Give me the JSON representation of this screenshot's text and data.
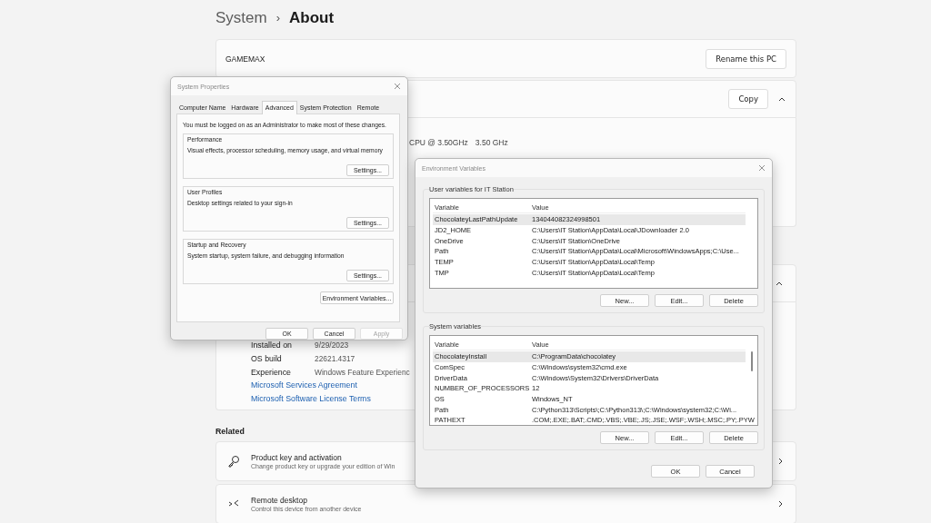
{
  "breadcrumb": {
    "parent": "System",
    "separator": "›",
    "current": "About"
  },
  "device_name": {
    "name": "GAMEMAX",
    "button": "Rename this PC"
  },
  "device_specs": {
    "expanded": true,
    "button": "Copy",
    "processor_fragment": "CPU @ 3.50GHz",
    "processor_speed": "3.50 GHz"
  },
  "windows_specs": {
    "expanded": true,
    "rows": [
      {
        "label": "Installed on",
        "value": "9/29/2023"
      },
      {
        "label": "OS build",
        "value": "22621.4317"
      },
      {
        "label": "Experience",
        "value": "Windows Feature Experienc"
      }
    ],
    "links": [
      "Microsoft Services Agreement",
      "Microsoft Software License Terms"
    ]
  },
  "related": {
    "heading": "Related",
    "items": [
      {
        "kind": "key",
        "title": "Product key and activation",
        "subtitle": "Change product key or upgrade your edition of Win"
      },
      {
        "kind": "remote",
        "title": "Remote desktop",
        "subtitle": "Control this device from another device"
      }
    ]
  },
  "system_properties": {
    "title": "System Properties",
    "tabs": [
      {
        "label": "Computer Name",
        "selected": false
      },
      {
        "label": "Hardware",
        "selected": false
      },
      {
        "label": "Advanced",
        "selected": true
      },
      {
        "label": "System Protection",
        "selected": false
      },
      {
        "label": "Remote",
        "selected": false
      }
    ],
    "notice": "You must be logged on as an Administrator to make most of these changes.",
    "groups": [
      {
        "title": "Performance",
        "description": "Visual effects, processor scheduling, memory usage, and virtual memory",
        "button": "Settings..."
      },
      {
        "title": "User Profiles",
        "description": "Desktop settings related to your sign-in",
        "button": "Settings..."
      },
      {
        "title": "Startup and Recovery",
        "description": "System startup, system failure, and debugging information",
        "button": "Settings..."
      }
    ],
    "env_button": "Environment Variables...",
    "buttons": [
      {
        "label": "OK",
        "disabled": false
      },
      {
        "label": "Cancel",
        "disabled": false
      },
      {
        "label": "Apply",
        "disabled": true
      }
    ]
  },
  "environment_variables": {
    "title": "Environment Variables",
    "sections": [
      {
        "title": "User variables for IT Station",
        "columns": [
          "Variable",
          "Value"
        ],
        "scrollbar": false,
        "rows": [
          {
            "variable": "ChocolateyLastPathUpdate",
            "value": "134044082324998501",
            "selected": true
          },
          {
            "variable": "JD2_HOME",
            "value": "C:\\Users\\IT Station\\AppData\\Local\\JDownloader 2.0",
            "selected": false
          },
          {
            "variable": "OneDrive",
            "value": "C:\\Users\\IT Station\\OneDrive",
            "selected": false
          },
          {
            "variable": "Path",
            "value": "C:\\Users\\IT Station\\AppData\\Local\\Microsoft\\WindowsApps;C:\\Use...",
            "selected": false
          },
          {
            "variable": "TEMP",
            "value": "C:\\Users\\IT Station\\AppData\\Local\\Temp",
            "selected": false
          },
          {
            "variable": "TMP",
            "value": "C:\\Users\\IT Station\\AppData\\Local\\Temp",
            "selected": false
          }
        ],
        "buttons": [
          "New...",
          "Edit...",
          "Delete"
        ]
      },
      {
        "title": "System variables",
        "columns": [
          "Variable",
          "Value"
        ],
        "scrollbar": true,
        "rows": [
          {
            "variable": "ChocolateyInstall",
            "value": "C:\\ProgramData\\chocolatey",
            "selected": true
          },
          {
            "variable": "ComSpec",
            "value": "C:\\Windows\\system32\\cmd.exe",
            "selected": false
          },
          {
            "variable": "DriverData",
            "value": "C:\\Windows\\System32\\Drivers\\DriverData",
            "selected": false
          },
          {
            "variable": "NUMBER_OF_PROCESSORS",
            "value": "12",
            "selected": false
          },
          {
            "variable": "OS",
            "value": "Windows_NT",
            "selected": false
          },
          {
            "variable": "Path",
            "value": "C:\\Python313\\Scripts\\;C:\\Python313\\;C:\\Windows\\system32;C:\\Wi...",
            "selected": false
          },
          {
            "variable": "PATHEXT",
            "value": ".COM;.EXE;.BAT;.CMD;.VBS;.VBE;.JS;.JSE;.WSF;.WSH;.MSC;.PY;.PYW",
            "selected": false
          }
        ],
        "buttons": [
          "New...",
          "Edit...",
          "Delete"
        ]
      }
    ],
    "buttons": [
      "OK",
      "Cancel"
    ]
  }
}
